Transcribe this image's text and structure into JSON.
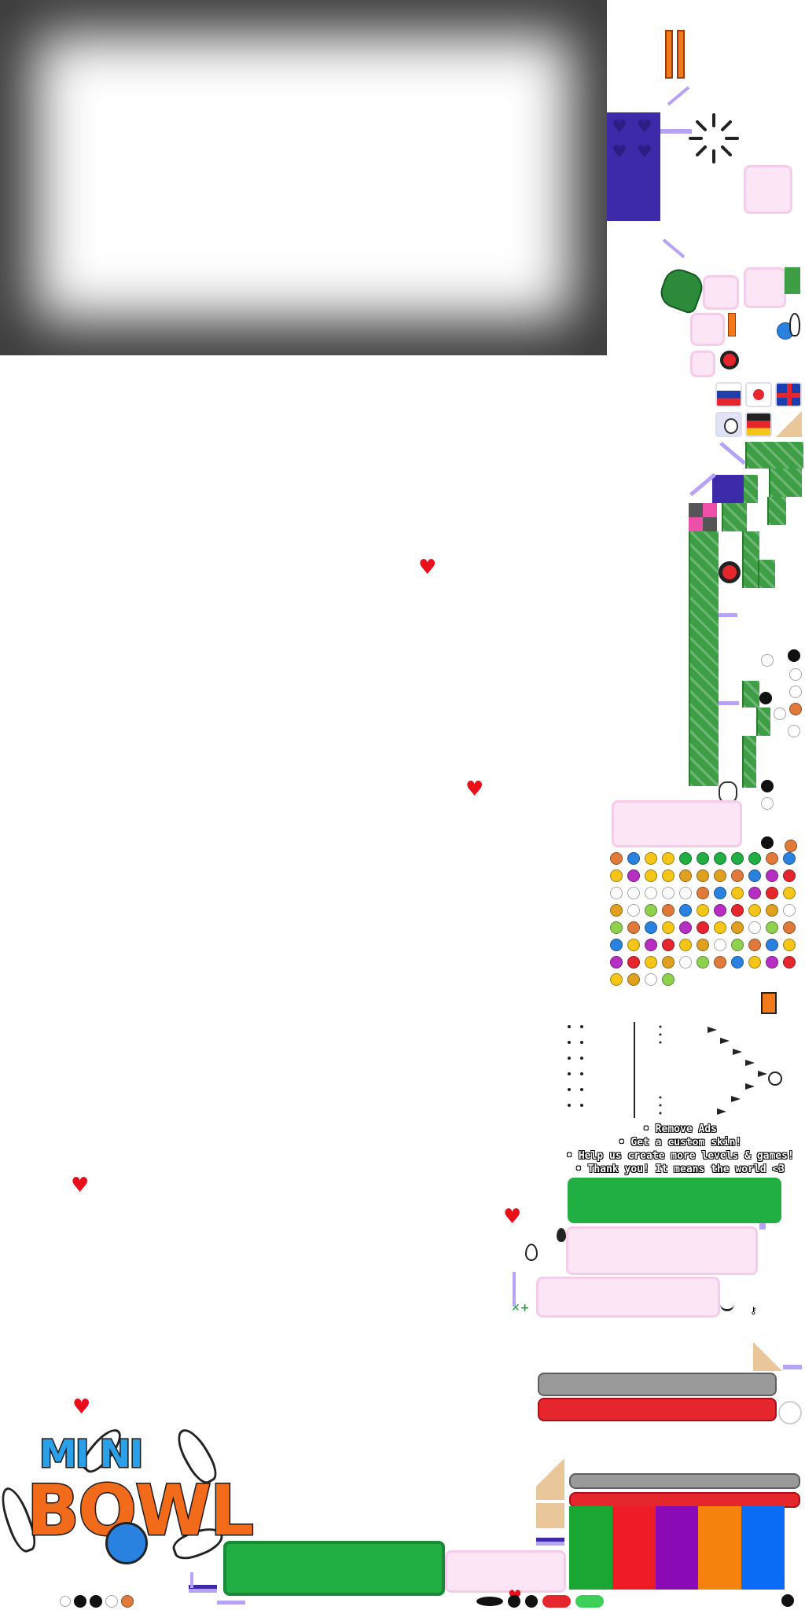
{
  "atlas": {
    "vignette_color": "#3a3a3a",
    "heart_glyph": "♥",
    "pause_glyph": "❚❚",
    "support_lines": [
      "• Remove Ads",
      "• Get a custom skin!",
      "• Help us create more levels & games!",
      "• Thank you! It means the world <3"
    ],
    "logo": {
      "line1": "MI NI",
      "line2": "BOWL"
    },
    "colors": {
      "green": "#21ae43",
      "pink_panel": "#fce6f5",
      "red": "#e5262d",
      "grey": "#9a9a9a",
      "palette": [
        "#1aa632",
        "#ee1c26",
        "#8a0bb5",
        "#f5820d",
        "#0a6cf5"
      ]
    },
    "icons": [
      "pause-icon",
      "loading-spinner-icon",
      "glove-icon",
      "bowling-pin-icon",
      "russian-flag-icon",
      "red-dot-icon",
      "uk-flag-icon",
      "german-flag-icon",
      "chef-icon",
      "heart-icon"
    ]
  }
}
